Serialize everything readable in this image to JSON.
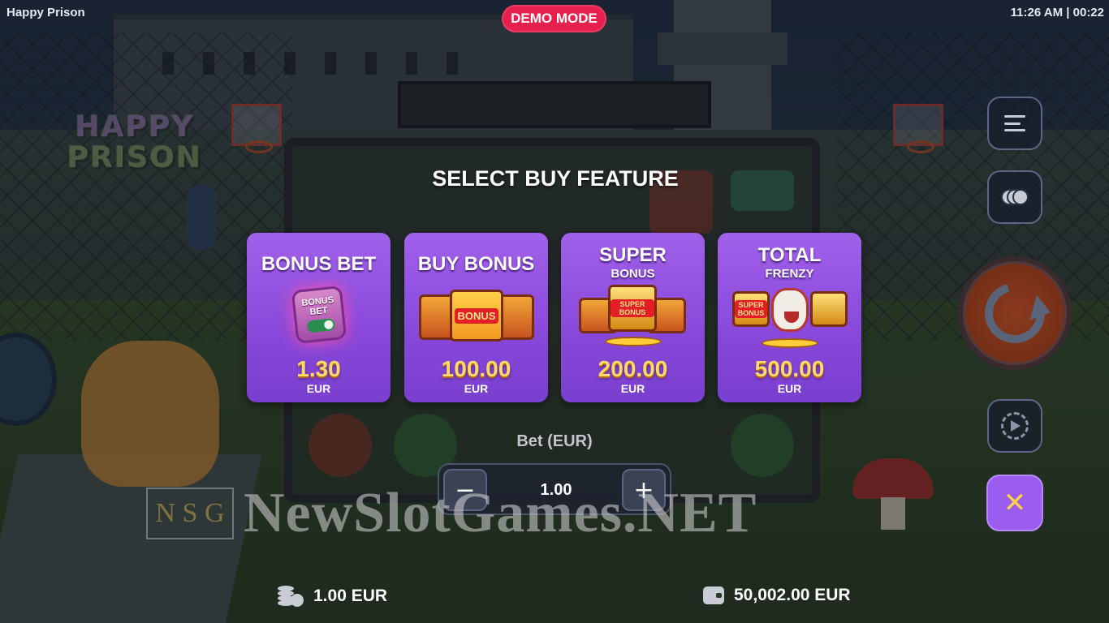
{
  "app": {
    "title": "Happy Prison"
  },
  "header": {
    "demo_badge": "DEMO MODE",
    "clock": "11:26 AM | 00:22"
  },
  "logo": {
    "line1": "HAPPY",
    "line2": "PRISON"
  },
  "buy_feature": {
    "title": "SELECT BUY FEATURE",
    "cards": [
      {
        "name": "BONUS BET",
        "subtitle": "",
        "art_text": "BONUS BET",
        "price": "1.30",
        "currency": "EUR"
      },
      {
        "name": "BUY BONUS",
        "subtitle": "",
        "art_text": "BONUS",
        "price": "100.00",
        "currency": "EUR"
      },
      {
        "name": "SUPER",
        "subtitle": "BONUS",
        "art_text": "SUPER BONUS",
        "price": "200.00",
        "currency": "EUR"
      },
      {
        "name": "TOTAL",
        "subtitle": "FRENZY",
        "art_text": "SUPER BONUS",
        "price": "500.00",
        "currency": "EUR"
      }
    ]
  },
  "bet": {
    "label": "Bet (EUR)",
    "value": "1.00",
    "minus": "−",
    "plus": "+"
  },
  "controls": {
    "close": "✕"
  },
  "watermark": {
    "mark": "N S G",
    "text": "NewSlotGames.NET"
  },
  "footer": {
    "stake": "1.00 EUR",
    "balance": "50,002.00 EUR"
  },
  "colors": {
    "accent_demo": "#e8204d",
    "card_purple": "#9b5cf0",
    "price_gold": "#ffd86a"
  }
}
